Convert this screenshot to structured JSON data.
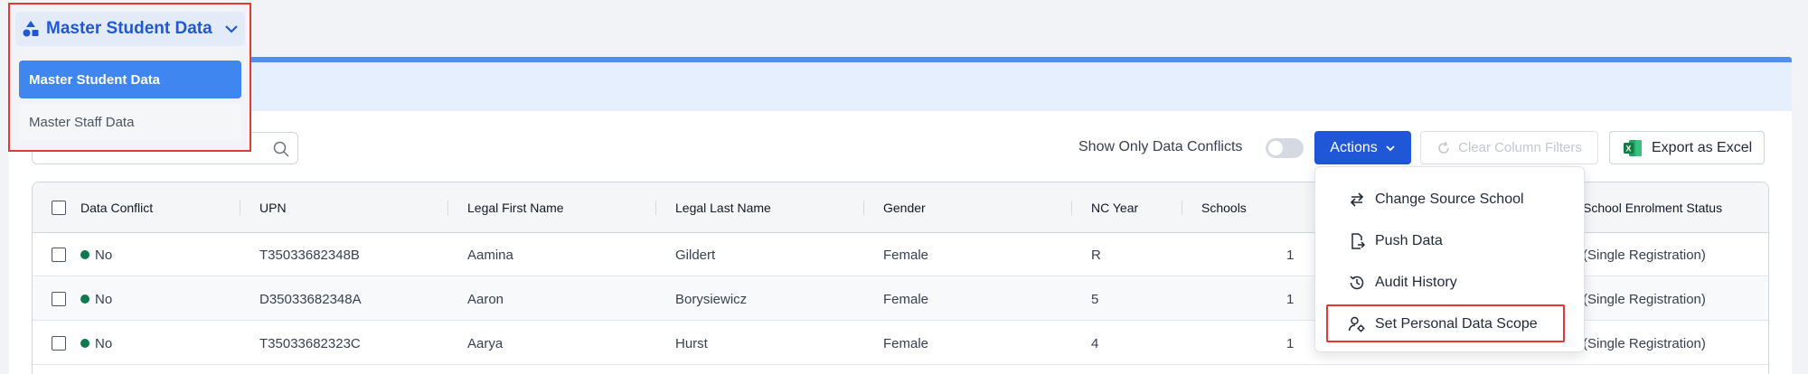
{
  "data_selector": {
    "current": "Master Student Data",
    "options": [
      "Master Student Data",
      "Master Staff Data"
    ]
  },
  "toolbar": {
    "show_conflicts_label": "Show Only Data Conflicts",
    "actions_label": "Actions",
    "clear_filters_label": "Clear Column Filters",
    "export_label": "Export as Excel"
  },
  "actions_menu": {
    "items": [
      "Change Source School",
      "Push Data",
      "Audit History",
      "Set Personal Data Scope"
    ]
  },
  "table": {
    "columns": [
      "Data Conflict",
      "UPN",
      "Legal First Name",
      "Legal Last Name",
      "Gender",
      "NC Year",
      "Schools",
      "School Enrolment Status"
    ],
    "rows": [
      {
        "conflict": "No",
        "upn": "T35033682348B",
        "first": "Aamina",
        "last": "Gildert",
        "gender": "Female",
        "nc_year": "R",
        "schools": "1",
        "status": "(Single Registration)"
      },
      {
        "conflict": "No",
        "upn": "D35033682348A",
        "first": "Aaron",
        "last": "Borysiewicz",
        "gender": "Female",
        "nc_year": "5",
        "schools": "1",
        "status": "(Single Registration)"
      },
      {
        "conflict": "No",
        "upn": "T35033682323C",
        "first": "Aarya",
        "last": "Hurst",
        "gender": "Female",
        "nc_year": "4",
        "schools": "1",
        "status": "(Single Registration)"
      }
    ]
  },
  "colors": {
    "primary": "#1f57d6",
    "selected_option": "#3f86f0",
    "no_conflict_dot": "#0f7a4f",
    "annotation_red": "#e23b2e"
  }
}
